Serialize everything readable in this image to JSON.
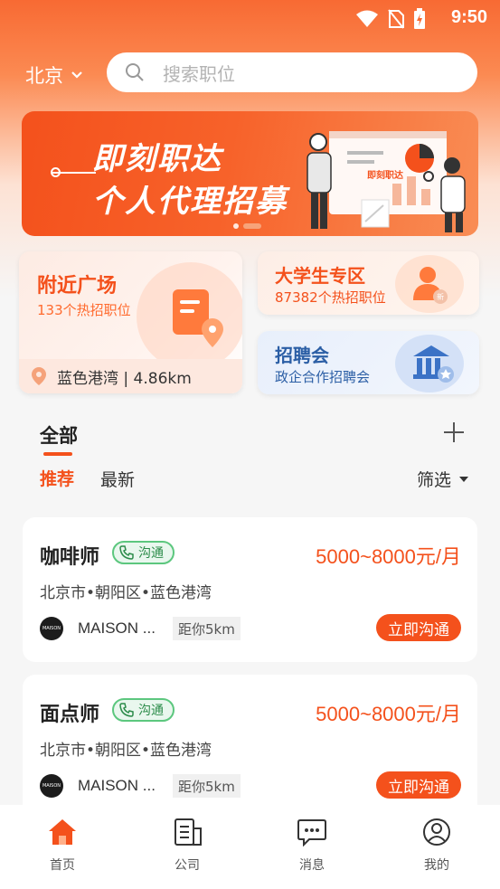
{
  "status_bar": {
    "time": "9:50",
    "icons": [
      "wifi-icon",
      "no-sim-icon",
      "battery-charging-icon"
    ]
  },
  "header": {
    "city": "北京",
    "search_placeholder": "搜索职位"
  },
  "banner": {
    "line1": "即刻职达",
    "line2": "个人代理招募",
    "badge": "即刻职达",
    "page_index": 2,
    "page_count": 2
  },
  "quick_entries": {
    "nearby": {
      "title": "附近广场",
      "subtitle": "133个热招职位",
      "location": "蓝色港湾 | 4.86km"
    },
    "college": {
      "title": "大学生专区",
      "subtitle": "87382个热招职位"
    },
    "job_fair": {
      "title": "招聘会",
      "subtitle": "政企合作招聘会"
    }
  },
  "tabs": {
    "main": "全部",
    "recommended": "推荐",
    "latest": "最新",
    "filter": "筛选"
  },
  "jobs": [
    {
      "title": "咖啡师",
      "tag": "沟通",
      "salary": "5000~8000元/月",
      "area": "北京市•朝阳区•蓝色港湾",
      "company": "MAISON ...",
      "distance": "距你5km",
      "action": "立即沟通",
      "logo_text": "MAISON"
    },
    {
      "title": "面点师",
      "tag": "沟通",
      "salary": "5000~8000元/月",
      "area": "北京市•朝阳区•蓝色港湾",
      "company": "MAISON ...",
      "distance": "距你5km",
      "action": "立即沟通",
      "logo_text": "MAISON"
    }
  ],
  "bottom_nav": [
    {
      "label": "首页",
      "icon": "home-icon",
      "active": true
    },
    {
      "label": "公司",
      "icon": "company-icon",
      "active": false
    },
    {
      "label": "消息",
      "icon": "message-icon",
      "active": false
    },
    {
      "label": "我的",
      "icon": "profile-icon",
      "active": false
    }
  ],
  "colors": {
    "accent": "#f4511c",
    "tag_green": "#5cc77e",
    "blue": "#2b5ea5"
  }
}
